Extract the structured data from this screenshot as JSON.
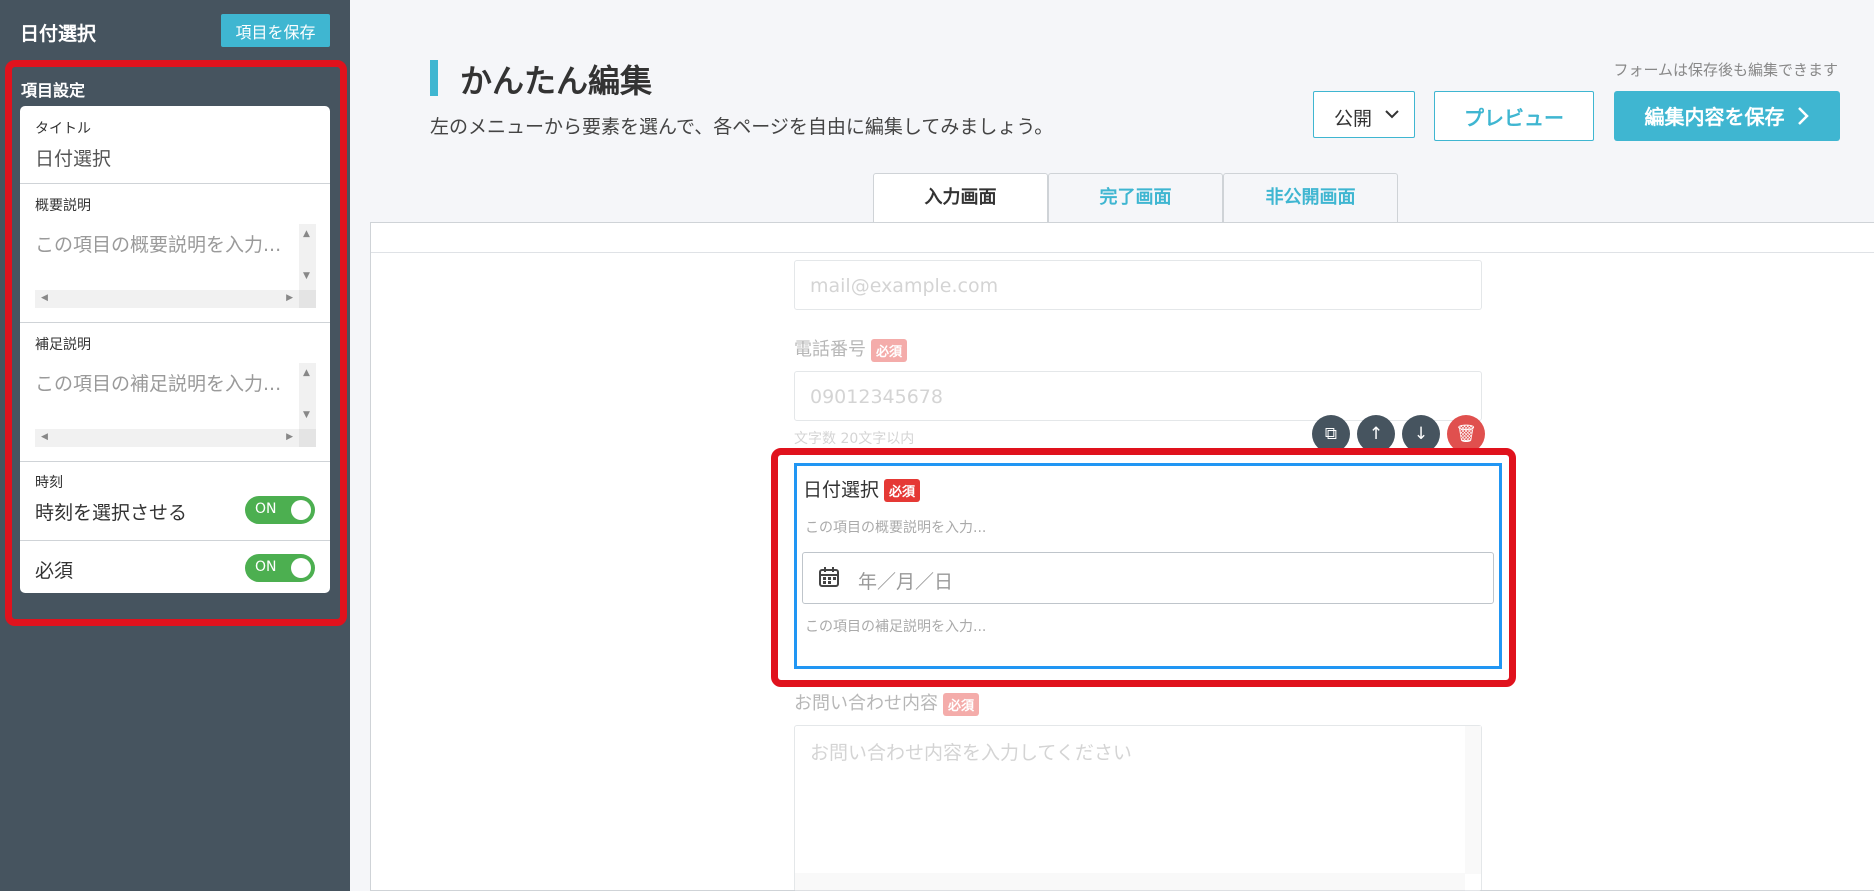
{
  "sidebar": {
    "header_title": "日付選択",
    "save_button": "項目を保存",
    "section_label": "項目設定",
    "title_field": {
      "label": "タイトル",
      "value": "日付選択"
    },
    "summary_field": {
      "label": "概要説明",
      "placeholder": "この項目の概要説明を入力..."
    },
    "supplement_field": {
      "label": "補足説明",
      "placeholder": "この項目の補足説明を入力..."
    },
    "time": {
      "label": "時刻",
      "option_label": "時刻を選択させる",
      "toggle": "ON"
    },
    "required": {
      "label": "必須",
      "toggle": "ON"
    }
  },
  "header": {
    "title": "かんたん編集",
    "subtitle": "左のメニューから要素を選んで、各ページを自由に編集してみましょう。",
    "note": "フォームは保存後も編集できます",
    "publish_select": "公開",
    "preview_button": "プレビュー",
    "save_button": "編集内容を保存"
  },
  "tabs": [
    {
      "label": "入力画面"
    },
    {
      "label": "完了画面"
    },
    {
      "label": "非公開画面"
    }
  ],
  "form": {
    "email_placeholder": "mail@example.com",
    "phone_label": "電話番号",
    "required_badge": "必須",
    "phone_placeholder": "09012345678",
    "phone_hint": "文字数 20文字以内",
    "date_label": "日付選択",
    "date_summary": "この項目の概要説明を入力...",
    "date_placeholder": "年／月／日",
    "date_supplement": "この項目の補足説明を入力...",
    "inquiry_label": "お問い合わせ内容",
    "inquiry_placeholder": "お問い合わせ内容を入力してください"
  },
  "colors": {
    "accent": "#3fb6d1",
    "sidebar": "#46545f",
    "highlight": "#e0121d",
    "toggle_on": "#4caf50"
  }
}
